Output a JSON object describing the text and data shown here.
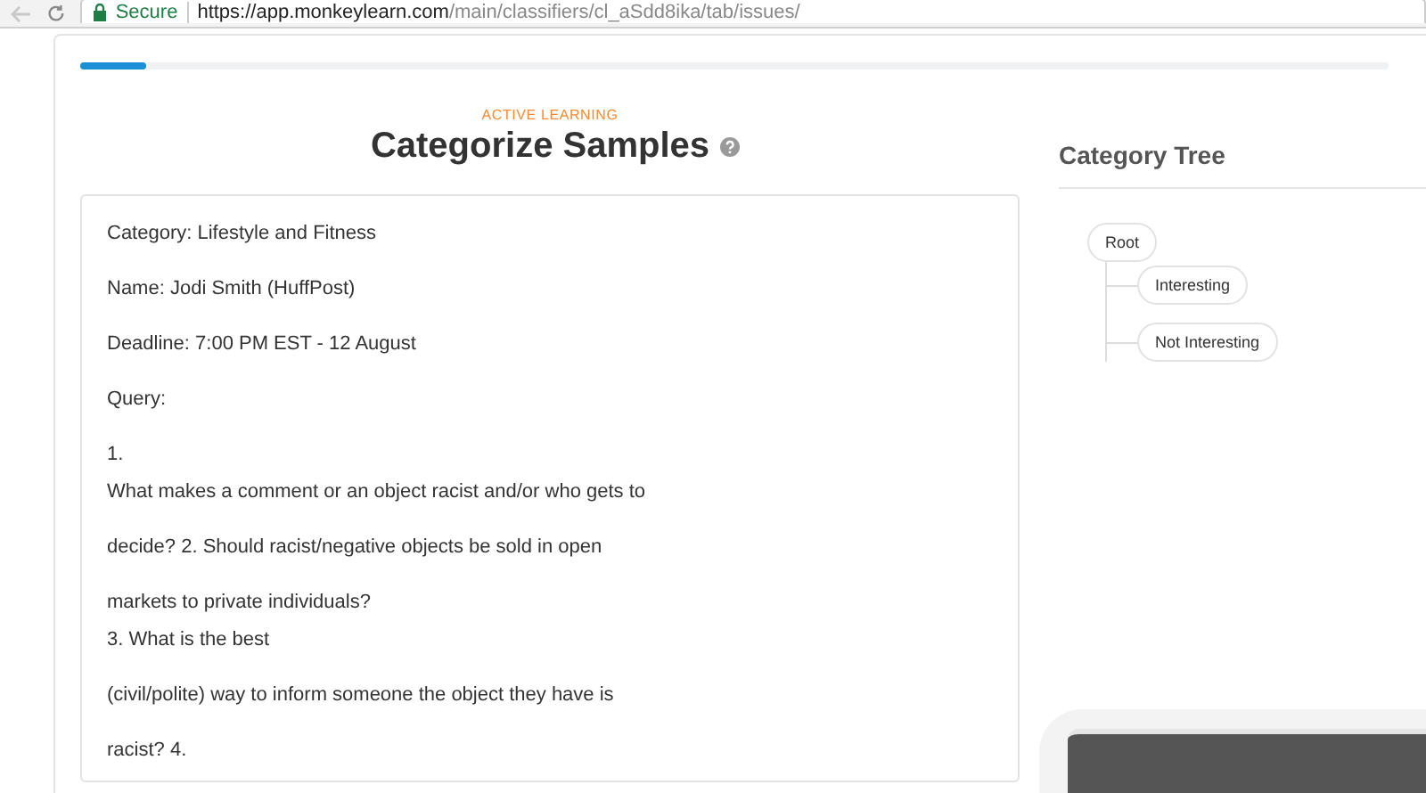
{
  "browser": {
    "security": "Secure",
    "url_host": "https://app.monkeylearn.com",
    "url_path": "/main/classifiers/cl_aSdd8ika/tab/issues/"
  },
  "progress": {
    "level": 0.05
  },
  "header": {
    "eyebrow": "ACTIVE LEARNING",
    "title": "Categorize Samples"
  },
  "sample": {
    "paragraphs": [
      [
        "Category: Lifestyle and Fitness"
      ],
      [
        "Name: Jodi Smith (HuffPost)"
      ],
      [
        "Deadline: 7:00 PM EST - 12 August"
      ],
      [
        "Query:"
      ],
      [
        "1.",
        "What makes a comment or an object racist and/or who gets to"
      ],
      [
        "decide? 2. Should racist/negative objects be sold in open"
      ],
      [
        "markets to private individuals?",
        "3. What is the best"
      ],
      [
        "(civil/polite) way to inform someone the object they have is"
      ],
      [
        "racist? 4."
      ]
    ]
  },
  "category_tree": {
    "title": "Category Tree",
    "root": {
      "label": "Root",
      "children": [
        {
          "label": "Interesting"
        },
        {
          "label": "Not Interesting"
        }
      ]
    }
  }
}
